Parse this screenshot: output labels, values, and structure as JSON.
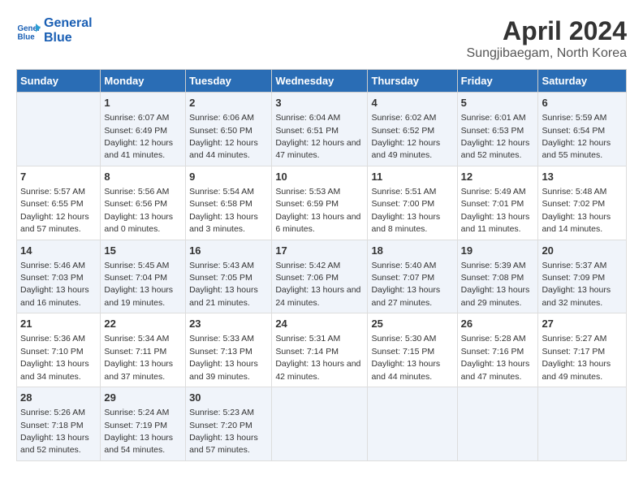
{
  "logo": {
    "line1": "General",
    "line2": "Blue"
  },
  "title": "April 2024",
  "subtitle": "Sungjibaegam, North Korea",
  "days_header": [
    "Sunday",
    "Monday",
    "Tuesday",
    "Wednesday",
    "Thursday",
    "Friday",
    "Saturday"
  ],
  "weeks": [
    [
      {
        "day": "",
        "sunrise": "",
        "sunset": "",
        "daylight": ""
      },
      {
        "day": "1",
        "sunrise": "Sunrise: 6:07 AM",
        "sunset": "Sunset: 6:49 PM",
        "daylight": "Daylight: 12 hours and 41 minutes."
      },
      {
        "day": "2",
        "sunrise": "Sunrise: 6:06 AM",
        "sunset": "Sunset: 6:50 PM",
        "daylight": "Daylight: 12 hours and 44 minutes."
      },
      {
        "day": "3",
        "sunrise": "Sunrise: 6:04 AM",
        "sunset": "Sunset: 6:51 PM",
        "daylight": "Daylight: 12 hours and 47 minutes."
      },
      {
        "day": "4",
        "sunrise": "Sunrise: 6:02 AM",
        "sunset": "Sunset: 6:52 PM",
        "daylight": "Daylight: 12 hours and 49 minutes."
      },
      {
        "day": "5",
        "sunrise": "Sunrise: 6:01 AM",
        "sunset": "Sunset: 6:53 PM",
        "daylight": "Daylight: 12 hours and 52 minutes."
      },
      {
        "day": "6",
        "sunrise": "Sunrise: 5:59 AM",
        "sunset": "Sunset: 6:54 PM",
        "daylight": "Daylight: 12 hours and 55 minutes."
      }
    ],
    [
      {
        "day": "7",
        "sunrise": "Sunrise: 5:57 AM",
        "sunset": "Sunset: 6:55 PM",
        "daylight": "Daylight: 12 hours and 57 minutes."
      },
      {
        "day": "8",
        "sunrise": "Sunrise: 5:56 AM",
        "sunset": "Sunset: 6:56 PM",
        "daylight": "Daylight: 13 hours and 0 minutes."
      },
      {
        "day": "9",
        "sunrise": "Sunrise: 5:54 AM",
        "sunset": "Sunset: 6:58 PM",
        "daylight": "Daylight: 13 hours and 3 minutes."
      },
      {
        "day": "10",
        "sunrise": "Sunrise: 5:53 AM",
        "sunset": "Sunset: 6:59 PM",
        "daylight": "Daylight: 13 hours and 6 minutes."
      },
      {
        "day": "11",
        "sunrise": "Sunrise: 5:51 AM",
        "sunset": "Sunset: 7:00 PM",
        "daylight": "Daylight: 13 hours and 8 minutes."
      },
      {
        "day": "12",
        "sunrise": "Sunrise: 5:49 AM",
        "sunset": "Sunset: 7:01 PM",
        "daylight": "Daylight: 13 hours and 11 minutes."
      },
      {
        "day": "13",
        "sunrise": "Sunrise: 5:48 AM",
        "sunset": "Sunset: 7:02 PM",
        "daylight": "Daylight: 13 hours and 14 minutes."
      }
    ],
    [
      {
        "day": "14",
        "sunrise": "Sunrise: 5:46 AM",
        "sunset": "Sunset: 7:03 PM",
        "daylight": "Daylight: 13 hours and 16 minutes."
      },
      {
        "day": "15",
        "sunrise": "Sunrise: 5:45 AM",
        "sunset": "Sunset: 7:04 PM",
        "daylight": "Daylight: 13 hours and 19 minutes."
      },
      {
        "day": "16",
        "sunrise": "Sunrise: 5:43 AM",
        "sunset": "Sunset: 7:05 PM",
        "daylight": "Daylight: 13 hours and 21 minutes."
      },
      {
        "day": "17",
        "sunrise": "Sunrise: 5:42 AM",
        "sunset": "Sunset: 7:06 PM",
        "daylight": "Daylight: 13 hours and 24 minutes."
      },
      {
        "day": "18",
        "sunrise": "Sunrise: 5:40 AM",
        "sunset": "Sunset: 7:07 PM",
        "daylight": "Daylight: 13 hours and 27 minutes."
      },
      {
        "day": "19",
        "sunrise": "Sunrise: 5:39 AM",
        "sunset": "Sunset: 7:08 PM",
        "daylight": "Daylight: 13 hours and 29 minutes."
      },
      {
        "day": "20",
        "sunrise": "Sunrise: 5:37 AM",
        "sunset": "Sunset: 7:09 PM",
        "daylight": "Daylight: 13 hours and 32 minutes."
      }
    ],
    [
      {
        "day": "21",
        "sunrise": "Sunrise: 5:36 AM",
        "sunset": "Sunset: 7:10 PM",
        "daylight": "Daylight: 13 hours and 34 minutes."
      },
      {
        "day": "22",
        "sunrise": "Sunrise: 5:34 AM",
        "sunset": "Sunset: 7:11 PM",
        "daylight": "Daylight: 13 hours and 37 minutes."
      },
      {
        "day": "23",
        "sunrise": "Sunrise: 5:33 AM",
        "sunset": "Sunset: 7:13 PM",
        "daylight": "Daylight: 13 hours and 39 minutes."
      },
      {
        "day": "24",
        "sunrise": "Sunrise: 5:31 AM",
        "sunset": "Sunset: 7:14 PM",
        "daylight": "Daylight: 13 hours and 42 minutes."
      },
      {
        "day": "25",
        "sunrise": "Sunrise: 5:30 AM",
        "sunset": "Sunset: 7:15 PM",
        "daylight": "Daylight: 13 hours and 44 minutes."
      },
      {
        "day": "26",
        "sunrise": "Sunrise: 5:28 AM",
        "sunset": "Sunset: 7:16 PM",
        "daylight": "Daylight: 13 hours and 47 minutes."
      },
      {
        "day": "27",
        "sunrise": "Sunrise: 5:27 AM",
        "sunset": "Sunset: 7:17 PM",
        "daylight": "Daylight: 13 hours and 49 minutes."
      }
    ],
    [
      {
        "day": "28",
        "sunrise": "Sunrise: 5:26 AM",
        "sunset": "Sunset: 7:18 PM",
        "daylight": "Daylight: 13 hours and 52 minutes."
      },
      {
        "day": "29",
        "sunrise": "Sunrise: 5:24 AM",
        "sunset": "Sunset: 7:19 PM",
        "daylight": "Daylight: 13 hours and 54 minutes."
      },
      {
        "day": "30",
        "sunrise": "Sunrise: 5:23 AM",
        "sunset": "Sunset: 7:20 PM",
        "daylight": "Daylight: 13 hours and 57 minutes."
      },
      {
        "day": "",
        "sunrise": "",
        "sunset": "",
        "daylight": ""
      },
      {
        "day": "",
        "sunrise": "",
        "sunset": "",
        "daylight": ""
      },
      {
        "day": "",
        "sunrise": "",
        "sunset": "",
        "daylight": ""
      },
      {
        "day": "",
        "sunrise": "",
        "sunset": "",
        "daylight": ""
      }
    ]
  ]
}
